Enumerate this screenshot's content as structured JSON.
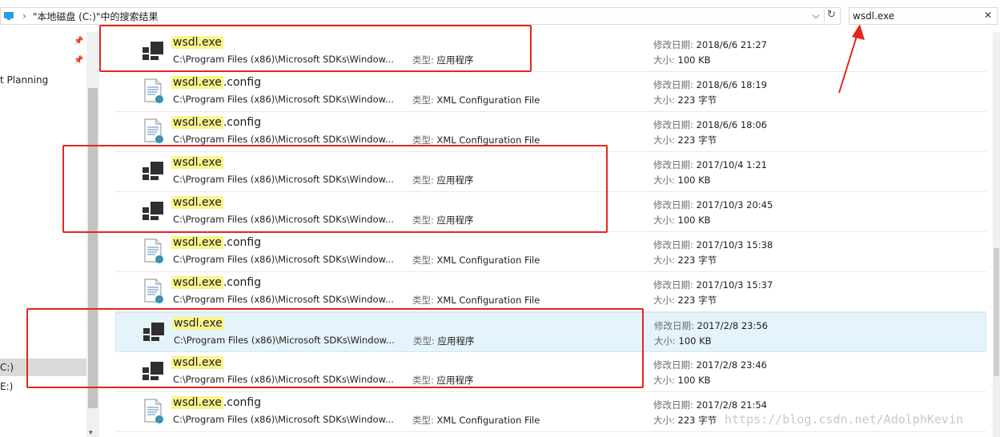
{
  "address": {
    "path_text": "\"本地磁盘 (C:)\"中的搜索结果",
    "separator": "›"
  },
  "search": {
    "value": "wsdl.exe"
  },
  "sidebar": {
    "items": [
      {
        "label": "t Planning"
      },
      {
        "label": "C:)"
      },
      {
        "label": "E:)"
      }
    ]
  },
  "labels": {
    "type": "类型: ",
    "date": "修改日期: ",
    "size": "大小: "
  },
  "files": [
    {
      "kind": "exe",
      "name_hl": "wsdl.exe",
      "name_rest": "",
      "path": "C:\\Program Files (x86)\\Microsoft SDKs\\Window...",
      "type": "应用程序",
      "date": "2018/6/6 21:27",
      "size": "100 KB"
    },
    {
      "kind": "cfg",
      "name_hl": "wsdl.exe",
      "name_rest": ".config",
      "path": "C:\\Program Files (x86)\\Microsoft SDKs\\Window...",
      "type": "XML Configuration File",
      "date": "2018/6/6 18:19",
      "size": "223 字节"
    },
    {
      "kind": "cfg",
      "name_hl": "wsdl.exe",
      "name_rest": ".config",
      "path": "C:\\Program Files (x86)\\Microsoft SDKs\\Window...",
      "type": "XML Configuration File",
      "date": "2018/6/6 18:06",
      "size": "223 字节"
    },
    {
      "kind": "exe",
      "name_hl": "wsdl.exe",
      "name_rest": "",
      "path": "C:\\Program Files (x86)\\Microsoft SDKs\\Window...",
      "type": "应用程序",
      "date": "2017/10/4 1:21",
      "size": "100 KB"
    },
    {
      "kind": "exe",
      "name_hl": "wsdl.exe",
      "name_rest": "",
      "path": "C:\\Program Files (x86)\\Microsoft SDKs\\Window...",
      "type": "应用程序",
      "date": "2017/10/3 20:45",
      "size": "100 KB"
    },
    {
      "kind": "cfg",
      "name_hl": "wsdl.exe",
      "name_rest": ".config",
      "path": "C:\\Program Files (x86)\\Microsoft SDKs\\Window...",
      "type": "XML Configuration File",
      "date": "2017/10/3 15:38",
      "size": "223 字节"
    },
    {
      "kind": "cfg",
      "name_hl": "wsdl.exe",
      "name_rest": ".config",
      "path": "C:\\Program Files (x86)\\Microsoft SDKs\\Window...",
      "type": "XML Configuration File",
      "date": "2017/10/3 15:37",
      "size": "223 字节"
    },
    {
      "kind": "exe",
      "name_hl": "wsdl.exe",
      "name_rest": "",
      "path": "C:\\Program Files (x86)\\Microsoft SDKs\\Window...",
      "type": "应用程序",
      "date": "2017/2/8 23:56",
      "size": "100 KB",
      "selected": true
    },
    {
      "kind": "exe",
      "name_hl": "wsdl.exe",
      "name_rest": "",
      "path": "C:\\Program Files (x86)\\Microsoft SDKs\\Window...",
      "type": "应用程序",
      "date": "2017/2/8 23:46",
      "size": "100 KB"
    },
    {
      "kind": "cfg",
      "name_hl": "wsdl.exe",
      "name_rest": ".config",
      "path": "C:\\Program Files (x86)\\Microsoft SDKs\\Window...",
      "type": "XML Configuration File",
      "date": "2017/2/8 21:54",
      "size": "223 字节"
    }
  ],
  "watermark": "https://blog.csdn.net/AdolphKevin",
  "colors": {
    "annotation": "#e3261f",
    "highlight": "#faf58c",
    "selection": "#e5f3fb"
  }
}
